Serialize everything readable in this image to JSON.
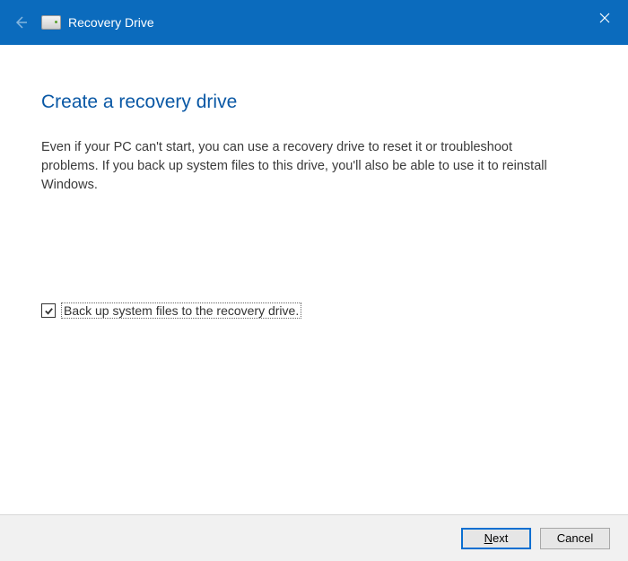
{
  "titlebar": {
    "title": "Recovery Drive"
  },
  "page": {
    "heading": "Create a recovery drive",
    "description": "Even if your PC can't start, you can use a recovery drive to reset it or troubleshoot problems. If you back up system files to this drive, you'll also be able to use it to reinstall Windows."
  },
  "options": {
    "backup_checked": true,
    "backup_label": "Back up system files to the recovery drive."
  },
  "footer": {
    "next_prefix": "N",
    "next_rest": "ext",
    "cancel": "Cancel"
  }
}
